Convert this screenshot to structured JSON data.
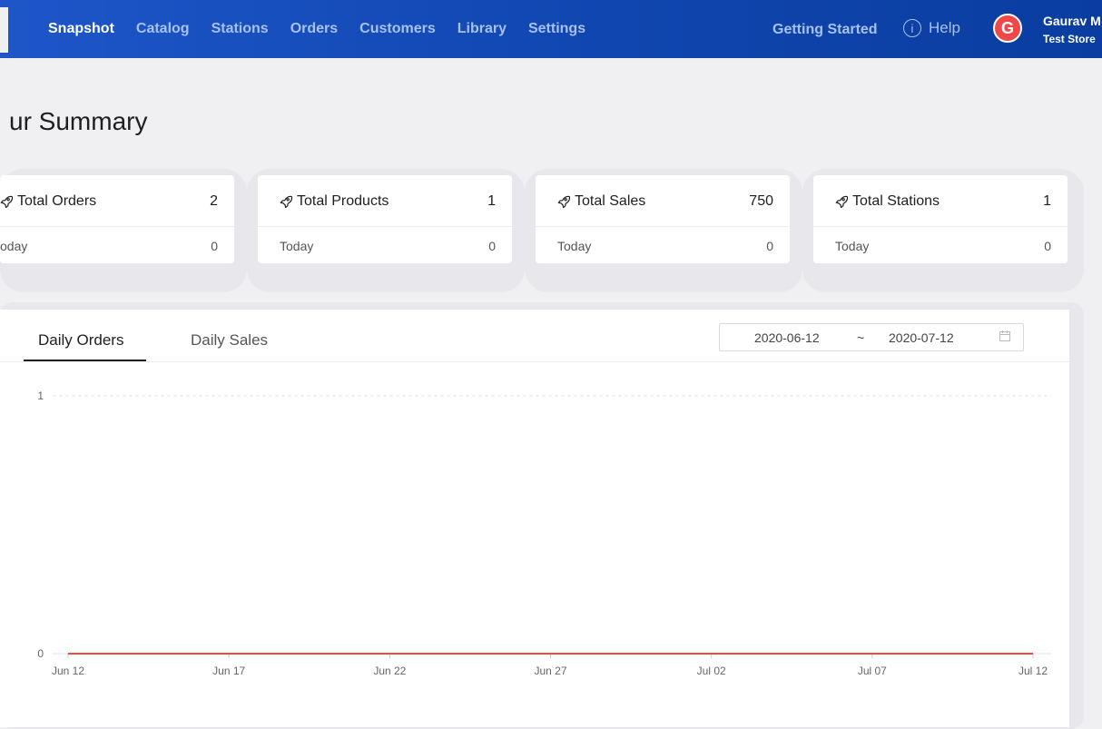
{
  "nav": {
    "items": [
      {
        "label": "Snapshot",
        "active": true
      },
      {
        "label": "Catalog",
        "active": false
      },
      {
        "label": "Stations",
        "active": false
      },
      {
        "label": "Orders",
        "active": false
      },
      {
        "label": "Customers",
        "active": false
      },
      {
        "label": "Library",
        "active": false
      },
      {
        "label": "Settings",
        "active": false
      }
    ],
    "getting_started": "Getting Started",
    "help_icon_text": "i",
    "help_label": "Help",
    "avatar_letter": "G",
    "user_name": "Gaurav M",
    "user_store": "Test Store"
  },
  "page": {
    "title": "ur Summary"
  },
  "cards": [
    {
      "label": "Total Orders",
      "value": "2",
      "sub_label": "oday",
      "sub_value": "0"
    },
    {
      "label": "Total Products",
      "value": "1",
      "sub_label": "Today",
      "sub_value": "0"
    },
    {
      "label": "Total Sales",
      "value": "750",
      "sub_label": "Today",
      "sub_value": "0"
    },
    {
      "label": "Total Stations",
      "value": "1",
      "sub_label": "Today",
      "sub_value": "0"
    }
  ],
  "tabs": {
    "daily_orders": "Daily Orders",
    "daily_sales": "Daily Sales"
  },
  "date_range": {
    "start": "2020-06-12",
    "separator": "~",
    "end": "2020-07-12"
  },
  "colors": {
    "header": "#1046b0",
    "line": "#f04848",
    "avatar": "#f04848"
  },
  "chart_data": {
    "type": "line",
    "x": [
      "Jun 12",
      "Jun 13",
      "Jun 14",
      "Jun 15",
      "Jun 16",
      "Jun 17",
      "Jun 18",
      "Jun 19",
      "Jun 20",
      "Jun 21",
      "Jun 22",
      "Jun 23",
      "Jun 24",
      "Jun 25",
      "Jun 26",
      "Jun 27",
      "Jun 28",
      "Jun 29",
      "Jun 30",
      "Jul 01",
      "Jul 02",
      "Jul 03",
      "Jul 04",
      "Jul 05",
      "Jul 06",
      "Jul 07",
      "Jul 08",
      "Jul 09",
      "Jul 10",
      "Jul 11",
      "Jul 12"
    ],
    "series": [
      {
        "values": [
          0,
          0,
          0,
          0,
          0,
          0,
          0,
          0,
          0,
          0,
          0,
          0,
          0,
          0,
          0,
          0,
          0,
          0,
          0,
          0,
          0,
          0,
          0,
          0,
          0,
          0,
          0,
          0,
          0,
          0,
          0
        ]
      }
    ],
    "x_ticks": [
      "Jun 12",
      "Jun 17",
      "Jun 22",
      "Jun 27",
      "Jul 02",
      "Jul 07",
      "Jul 12"
    ],
    "y_ticks": [
      "0",
      "1"
    ],
    "ylim": [
      0,
      1
    ],
    "grid": true
  }
}
